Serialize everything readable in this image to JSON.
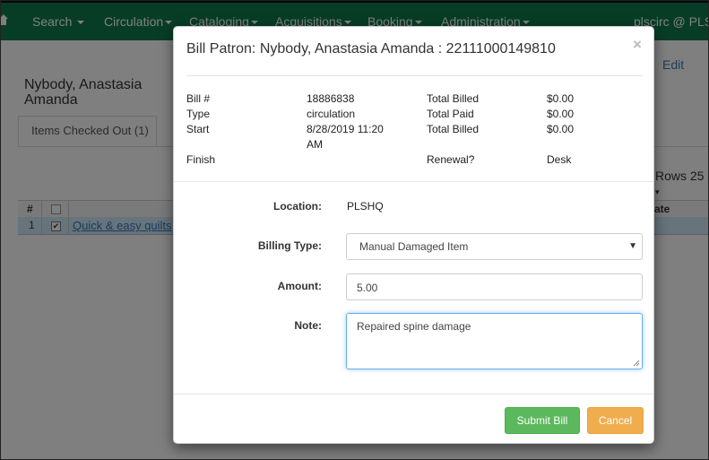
{
  "navbar": {
    "items": [
      {
        "label": "Search"
      },
      {
        "label": "Circulation"
      },
      {
        "label": "Cataloging"
      },
      {
        "label": "Acquisitions"
      },
      {
        "label": "Booking"
      },
      {
        "label": "Administration"
      }
    ],
    "user": "plscirc @ PLSH"
  },
  "page": {
    "patron_name": "Nybody, Anastasia Amanda",
    "edit_label": "Edit",
    "tab_label": "Items Checked Out (1)",
    "rows_label": "Rows 25",
    "grid": {
      "col_num": "#",
      "col_date": "ate",
      "row_num": "1",
      "row_check": "✔",
      "row_title": "Quick & easy quilts"
    }
  },
  "modal": {
    "title": "Bill Patron: Nybody, Anastasia Amanda : 22111000149810",
    "close_label": "×",
    "info": {
      "bill_label": "Bill #",
      "bill_value": "18886838",
      "type_label": "Type",
      "type_value": "circulation",
      "start_label": "Start",
      "start_value": "8/28/2019 11:20 AM",
      "finish_label": "Finish",
      "total_billed_label": "Total Billed",
      "total_billed_value": "$0.00",
      "total_paid_label": "Total Paid",
      "total_paid_value": "$0.00",
      "total_billed2_label": "Total Billed",
      "total_billed2_value": "$0.00",
      "renewal_label": "Renewal?",
      "renewal_value": "Desk"
    },
    "form": {
      "location_label": "Location:",
      "location_value": "PLSHQ",
      "billing_type_label": "Billing Type:",
      "billing_type_value": "Manual Damaged Item",
      "amount_label": "Amount:",
      "amount_value": "5.00",
      "note_label": "Note:",
      "note_value": "Repaired spine damage"
    },
    "buttons": {
      "submit": "Submit Bill",
      "cancel": "Cancel"
    }
  },
  "colors": {
    "navbar": "#0f7b4f",
    "submit": "#5cb85c",
    "cancel": "#f0ad4e",
    "link": "#337ab7"
  }
}
